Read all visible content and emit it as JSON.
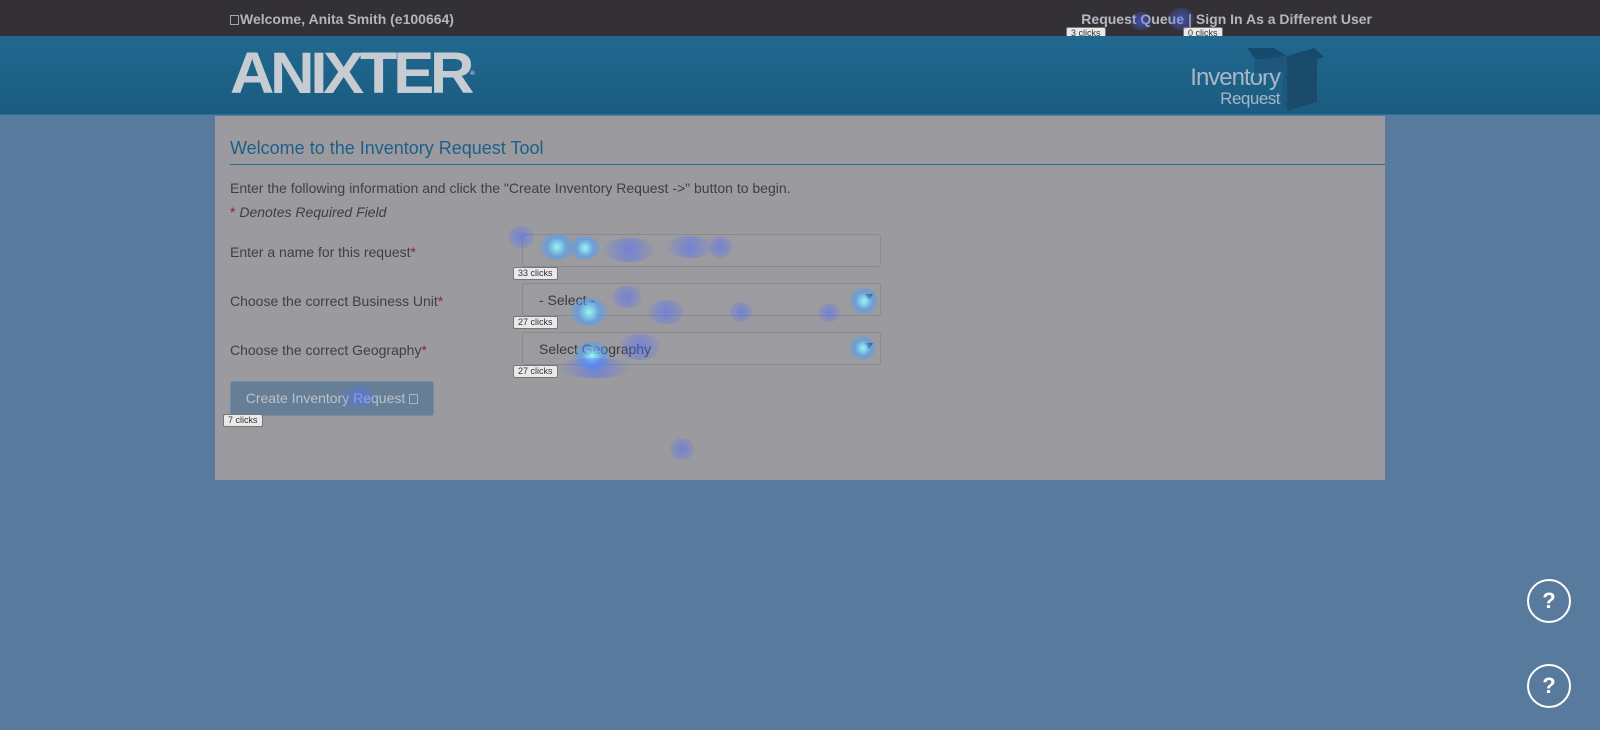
{
  "topbar": {
    "welcome_text": "Welcome, Anita Smith (e100664)",
    "links": [
      {
        "label": "Request Queue"
      },
      {
        "separator": "|"
      },
      {
        "label": "Sign In As a Different User"
      }
    ],
    "click_badges": [
      "3 clicks",
      "0 clicks"
    ]
  },
  "header": {
    "logo_text": "ANIXTER",
    "logo_mark": "®",
    "brand_line1": "Inventory",
    "brand_line2": "Request",
    "brand_icon": "box-icon"
  },
  "panel": {
    "title": "Welcome to the Inventory Request Tool",
    "instructions": "Enter the following information and click the \"Create Inventory Request ->\" button to begin.",
    "required_star": "*",
    "required_note": " Denotes Required Field",
    "fields": [
      {
        "label": "Enter a name for this request",
        "star": "*",
        "value": "",
        "badge": "33 clicks"
      },
      {
        "label": "Choose the correct Business Unit",
        "star": "*",
        "value": "- Select -",
        "badge": "27 clicks"
      },
      {
        "label": "Choose the correct Geography",
        "star": "*",
        "value": "Select Geography",
        "badge": "27 clicks"
      }
    ],
    "create_button": "Create Inventory Request",
    "create_badge": "7 clicks"
  },
  "help": {
    "label": "?"
  },
  "colors": {
    "topbar": "#333135",
    "header": "#1d5f84",
    "page_bg": "#587b9d",
    "panel_bg": "#9b9a9e",
    "title": "#1d5f8a",
    "required": "#8b2730",
    "heatmap": "#60d8ff"
  }
}
